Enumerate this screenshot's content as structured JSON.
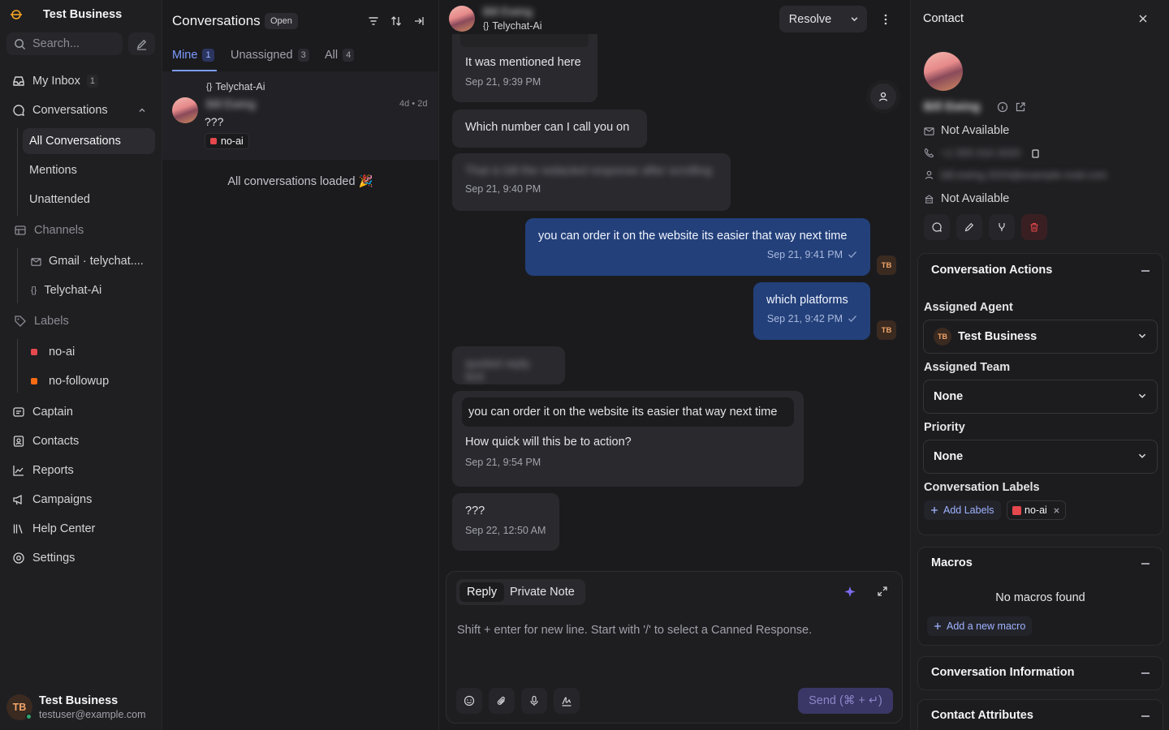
{
  "workspace": {
    "name": "Test Business"
  },
  "search": {
    "placeholder": "Search..."
  },
  "nav": {
    "my_inbox": {
      "label": "My Inbox",
      "count": "1"
    },
    "conversations": {
      "label": "Conversations"
    },
    "conv_sub": [
      "All Conversations",
      "Mentions",
      "Unattended"
    ],
    "channels": {
      "label": "Channels",
      "items": [
        "Gmail · telychat....",
        "Telychat-Ai"
      ]
    },
    "labels": {
      "label": "Labels",
      "items": [
        "no-ai",
        "no-followup"
      ]
    },
    "bottom": [
      "Captain",
      "Contacts",
      "Reports",
      "Campaigns",
      "Help Center",
      "Settings"
    ]
  },
  "user": {
    "initials": "TB",
    "name": "Test Business",
    "email": "testuser@example.com"
  },
  "convlist": {
    "title": "Conversations",
    "status": "Open",
    "tabs": [
      {
        "label": "Mine",
        "count": "1"
      },
      {
        "label": "Unassigned",
        "count": "3"
      },
      {
        "label": "All",
        "count": "4"
      }
    ],
    "card": {
      "inbox": "Telychat-Ai",
      "name": "Bill Ewing",
      "time": "4d • 2d",
      "message": "???",
      "label": "no-ai"
    },
    "footer": "All conversations loaded 🎉"
  },
  "chat": {
    "contact_name": "Bill Ewing",
    "inbox": "Telychat-Ai",
    "resolve_label": "Resolve",
    "messages": [
      {
        "text": "It was mentioned here",
        "time": "Sep 21, 9:39 PM"
      },
      {
        "text": "Which number can I call you on"
      },
      {
        "text": "That is bill the redacted response after scrolling",
        "time": "Sep 21, 9:40 PM"
      },
      {
        "text": "you can order it on the website its easier that way next time",
        "time": "Sep 21, 9:41 PM"
      },
      {
        "text": "which platforms",
        "time": "Sep 21, 9:42 PM"
      },
      {
        "text": "quoted reply text"
      },
      {
        "quote": "you can order it on the website its easier that way next time",
        "text": "How quick will this be to action?",
        "time": "Sep 21, 9:54 PM"
      },
      {
        "text": "???",
        "time": "Sep 22, 12:50 AM"
      }
    ],
    "agent_initials": "TB"
  },
  "composer": {
    "tab_reply": "Reply",
    "tab_note": "Private Note",
    "placeholder": "Shift + enter for new line. Start with '/' to select a Canned Response.",
    "send_label": "Send (⌘ + ↵)"
  },
  "contact": {
    "header": "Contact",
    "name": "Bill Ewing",
    "email": "Not Available",
    "phone": "+1 555 010 2020",
    "social": "bill.ewing.2024@example-mail.com",
    "company": "Not Available",
    "conversation_actions": "Conversation Actions",
    "assigned_agent_label": "Assigned Agent",
    "assigned_agent": "Test Business",
    "assigned_agent_initials": "TB",
    "assigned_team_label": "Assigned Team",
    "assigned_team": "None",
    "priority_label": "Priority",
    "priority": "None",
    "labels_label": "Conversation Labels",
    "add_labels": "Add Labels",
    "label_chip": "no-ai",
    "macros": "Macros",
    "no_macros": "No macros found",
    "add_macro": "Add a new macro",
    "conv_info": "Conversation Information",
    "contact_attrs": "Contact Attributes"
  },
  "colors": {
    "accent": "#7c9bff",
    "label_red": "#e5484d",
    "label_orange": "#f76b15",
    "outgoing": "#23407a",
    "online": "#30a46c"
  },
  "icons": [
    "logo-icon",
    "search-icon",
    "compose-icon",
    "inbox-icon",
    "chat-icon",
    "chevron-up-icon",
    "channels-icon",
    "mail-icon",
    "code-icon",
    "tag-icon",
    "captain-icon",
    "contacts-icon",
    "reports-icon",
    "campaigns-icon",
    "help-icon",
    "settings-icon",
    "filter-icon",
    "sort-icon",
    "collapse-icon",
    "chevron-down-icon",
    "more-icon",
    "person-icon",
    "check-icon",
    "sparkle-icon",
    "expand-icon",
    "emoji-icon",
    "attach-icon",
    "mic-icon",
    "signature-icon",
    "close-icon",
    "info-icon",
    "external-link-icon",
    "phone-icon",
    "copy-icon",
    "company-icon",
    "message-icon",
    "edit-icon",
    "merge-icon",
    "trash-icon",
    "plus-icon"
  ]
}
